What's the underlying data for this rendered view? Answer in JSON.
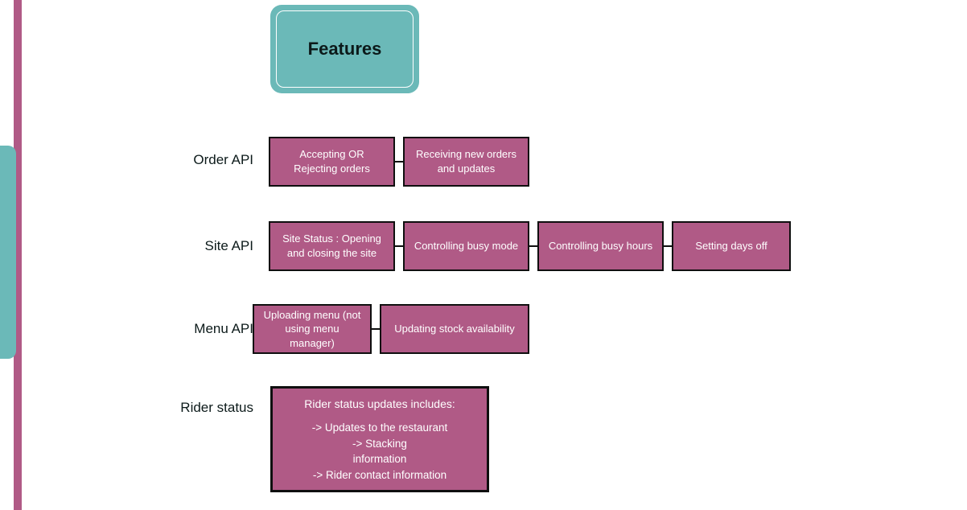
{
  "header": {
    "title": "Features"
  },
  "rows": {
    "orderApi": {
      "label": "Order API",
      "items": [
        "Accepting OR Rejecting orders",
        "Receiving new orders and updates"
      ]
    },
    "siteApi": {
      "label": "Site API",
      "items": [
        "Site Status : Opening and closing the site",
        "Controlling busy mode",
        "Controlling busy hours",
        "Setting days off"
      ]
    },
    "menuApi": {
      "label": "Menu API",
      "items": [
        "Uploading menu (not using menu manager)",
        "Updating stock availability"
      ]
    },
    "riderStatus": {
      "label": "Rider status",
      "title": "Rider status updates includes:",
      "lines": [
        "-> Updates to the restaurant",
        "-> Stacking",
        "information",
        "-> Rider contact information"
      ]
    }
  }
}
